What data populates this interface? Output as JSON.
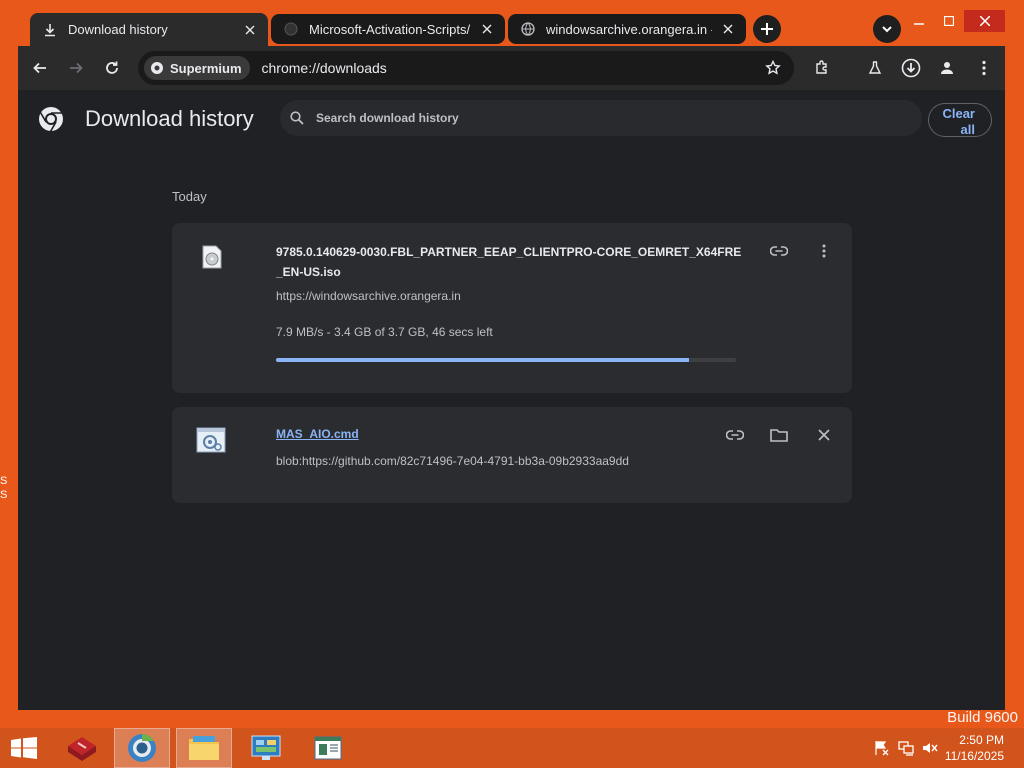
{
  "desktop": {
    "side_glyphs": [
      "S",
      "S"
    ],
    "build_text": "Build 9600"
  },
  "browser": {
    "tabs": [
      {
        "label": "Download history",
        "icon": "download-icon",
        "active": true
      },
      {
        "label": "Microsoft-Activation-Scripts/MA",
        "icon": "github-icon",
        "active": false
      },
      {
        "label": "windowsarchive.orangera.in - /w",
        "icon": "globe-icon",
        "active": false
      }
    ],
    "toolbar": {
      "chip_label": "Supermium",
      "url": "chrome://downloads"
    }
  },
  "page": {
    "title": "Download history",
    "search_placeholder": "Search download history",
    "clear_all_label": "Clear all",
    "section_label": "Today",
    "downloads": [
      {
        "file_name": "9785.0.140629-0030.FBL_PARTNER_EEAP_CLIENTPRO-CORE_OEMRET_X64FRE_EN-US.iso",
        "source": "https://windowsarchive.orangera.in",
        "status": "7.9 MB/s - 3.4 GB of 3.7 GB, 46 secs left",
        "progress_fraction": 0.897,
        "icon": "disc-image-icon"
      },
      {
        "file_name": "MAS_AIO.cmd",
        "source": "blob:https://github.com/82c71496-7e04-4791-bb3a-09b2933aa9dd",
        "icon": "cmd-script-icon"
      }
    ]
  },
  "taskbar": {
    "clock_time": "2:50 PM",
    "clock_date": "11/16/2025"
  },
  "colors": {
    "desktop_orange": "#e8581b",
    "accent_blue": "#8ab4f8",
    "page_bg": "#202124",
    "card_bg": "#2b2c2f"
  }
}
